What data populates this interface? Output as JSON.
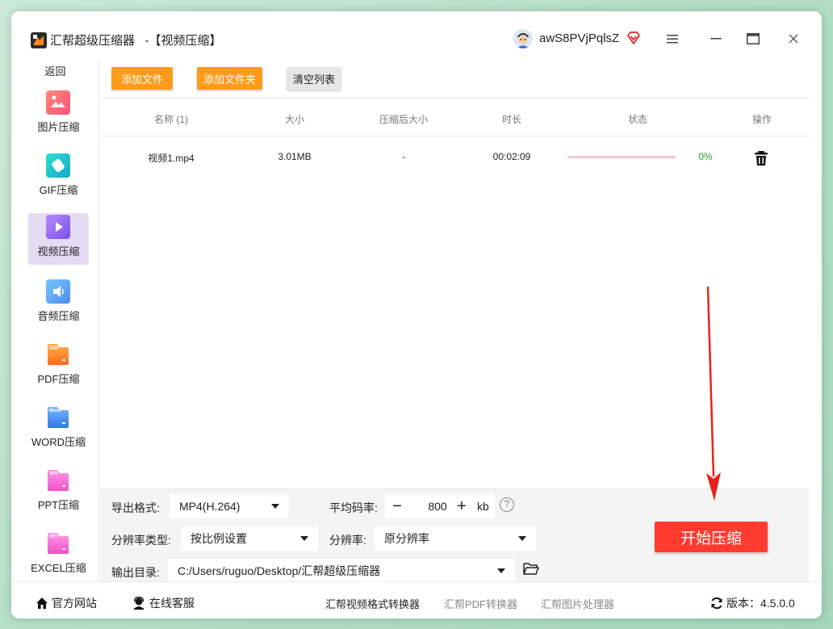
{
  "window": {
    "title": "汇帮超级压缩器   -【视频压缩】",
    "username": "awS8PVjPqlsZ",
    "controls": [
      "menu-icon",
      "minimize-icon",
      "maximize-icon",
      "close-icon"
    ]
  },
  "sidebar": {
    "back_label": "返回",
    "items": [
      {
        "label": "图片压缩",
        "icon": "image-compress-icon",
        "color": "#ff5f6d",
        "active": false
      },
      {
        "label": "GIF压缩",
        "icon": "gif-compress-icon",
        "color": "#20c8c8",
        "active": false
      },
      {
        "label": "视频压缩",
        "icon": "video-compress-icon",
        "color": "#8b5cf6",
        "active": true
      },
      {
        "label": "音频压缩",
        "icon": "audio-compress-icon",
        "color": "#5aa8f0",
        "active": false
      },
      {
        "label": "PDF压缩",
        "icon": "pdf-compress-icon",
        "color": "#ff8a2a",
        "active": false
      },
      {
        "label": "WORD压缩",
        "icon": "word-compress-icon",
        "color": "#3a8cf0",
        "active": false
      },
      {
        "label": "PPT压缩",
        "icon": "ppt-compress-icon",
        "color": "#ff6fd1",
        "active": false
      },
      {
        "label": "EXCEL压缩",
        "icon": "excel-compress-icon",
        "color": "#ff6fd1",
        "active": false
      }
    ],
    "pdf_tag": "PDF",
    "word_tag": "Word",
    "ppt_tag": "PPT"
  },
  "toolbar": {
    "add_file": "添加文件",
    "add_folder": "添加文件夹",
    "clear_list": "清空列表"
  },
  "table": {
    "headers": {
      "name": "名称 (1)",
      "size": "大小",
      "compressed_size": "压缩后大小",
      "duration": "时长",
      "status": "状态",
      "actions": "操作"
    },
    "rows": [
      {
        "name": "视频1.mp4",
        "size": "3.01MB",
        "compressed_size": "-",
        "duration": "00:02:09",
        "progress_percent": 0,
        "progress_text": "0%"
      }
    ]
  },
  "settings": {
    "format_label": "导出格式:",
    "format_value": "MP4(H.264)",
    "bitrate_label": "平均码率:",
    "bitrate_value": "800",
    "bitrate_minus": "−",
    "bitrate_plus": "+",
    "bitrate_unit": "kb",
    "help_glyph": "?",
    "res_type_label": "分辨率类型:",
    "res_type_value": "按比例设置",
    "res_label": "分辨率:",
    "res_value": "原分辨率",
    "output_label": "输出目录:",
    "output_value": "C:/Users/ruguo/Desktop/汇帮超级压缩器",
    "start_button": "开始压缩"
  },
  "footer": {
    "website": "官方网站",
    "support": "在线客服",
    "links": [
      "汇帮视频格式转换器",
      "汇帮PDF转换器",
      "汇帮图片处理器"
    ],
    "version": "版本：4.5.0.0"
  },
  "colors": {
    "accent_orange": "#ff9b1a",
    "start_red": "#ff3b30",
    "progress_green": "#1e9e2a",
    "active_sidebar": "#e4dcf3"
  }
}
